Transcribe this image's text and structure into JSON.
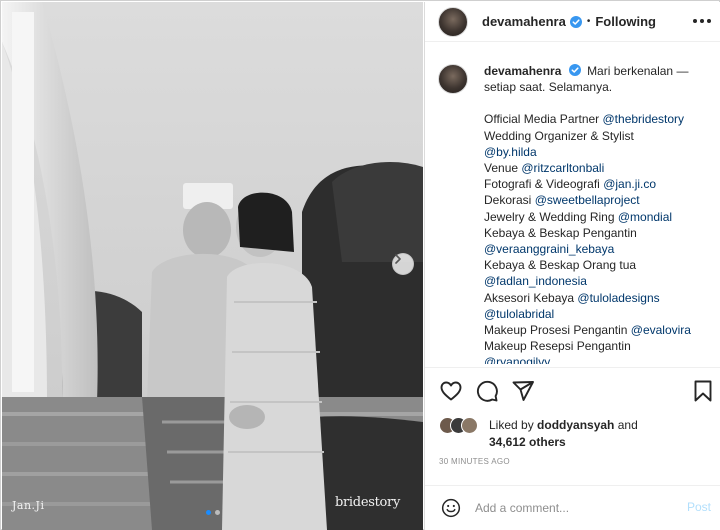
{
  "post": {
    "username": "devamahenra",
    "following_label": "Following",
    "caption_intro": "Mari berkenalan —",
    "caption_intro_2": "setiap saat. Selamanya.",
    "credits": [
      {
        "text": "Official Media Partner ",
        "mention": "@thebridestory"
      },
      {
        "text": "Wedding Organizer & Stylist",
        "mention": ""
      },
      {
        "text": "",
        "mention": "@by.hilda"
      },
      {
        "text": "Venue ",
        "mention": "@ritzcarltonbali"
      },
      {
        "text": "Fotografi & Videografi ",
        "mention": "@jan.ji.co"
      },
      {
        "text": "Dekorasi ",
        "mention": "@sweetbellaproject"
      },
      {
        "text": "Jewelry & Wedding Ring ",
        "mention": "@mondial"
      },
      {
        "text": "Kebaya & Beskap Pengantin",
        "mention": ""
      },
      {
        "text": "",
        "mention": "@veraanggraini_kebaya"
      },
      {
        "text": "Kebaya & Beskap Orang tua",
        "mention": ""
      },
      {
        "text": "",
        "mention": "@fadlan_indonesia"
      },
      {
        "text": "Aksesori Kebaya ",
        "mention": "@tuloladesigns"
      },
      {
        "text": "",
        "mention": "@tulolabridal"
      },
      {
        "text": "Makeup Prosesi Pengantin ",
        "mention": "@evalovira"
      },
      {
        "text": "Makeup Resepsi Pengantin",
        "mention": ""
      },
      {
        "text": "",
        "mention": "@ryanogilvy"
      }
    ],
    "likes_prefix": "Liked by ",
    "liked_by_user": "doddyansyah",
    "likes_and": " and",
    "likes_count": "34,612",
    "likes_others": " others",
    "timestamp": "30 MINUTES AGO",
    "photo_watermark_left": "Jan.Ji",
    "photo_watermark_right": "bridestory",
    "carousel_total": 2,
    "carousel_active": 1
  },
  "comment": {
    "placeholder": "Add a comment...",
    "post_label": "Post"
  },
  "colors": {
    "mention": "#00376b",
    "verified": "#3897f0",
    "post_disabled": "#b2dffc",
    "timestamp": "#8e8e8e"
  },
  "icons": {
    "like": "heart-outline-icon",
    "comment": "speech-bubble-icon",
    "share": "paper-plane-icon",
    "save": "bookmark-icon",
    "emoji": "smiley-icon",
    "more": "three-dots-icon",
    "next": "chevron-right-icon"
  }
}
